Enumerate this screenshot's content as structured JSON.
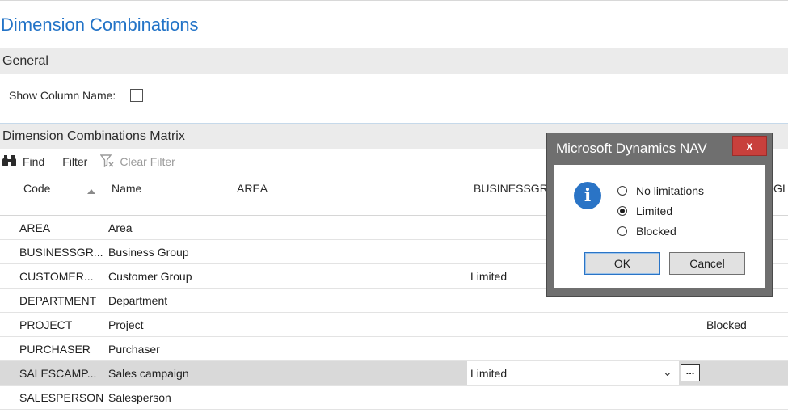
{
  "page": {
    "title": "Dimension Combinations"
  },
  "general": {
    "header": "General",
    "show_column_name_label": "Show Column Name:",
    "show_column_name_checked": false
  },
  "matrix": {
    "header": "Dimension Combinations Matrix",
    "toolbar": {
      "find": "Find",
      "filter": "Filter",
      "clear_filter": "Clear Filter"
    },
    "columns": {
      "code": "Code",
      "name": "Name",
      "area": "AREA",
      "businessgroup": "BUSINESSGR",
      "customergroup_partial": "GI"
    },
    "rows": [
      {
        "code": "AREA",
        "name": "Area",
        "businessgroup": "",
        "customergroup": ""
      },
      {
        "code": "BUSINESSGR...",
        "name": "Business Group",
        "businessgroup": "",
        "customergroup": ""
      },
      {
        "code": "CUSTOMER...",
        "name": "Customer Group",
        "businessgroup": "Limited",
        "customergroup": ""
      },
      {
        "code": "DEPARTMENT",
        "name": "Department",
        "businessgroup": "",
        "customergroup": ""
      },
      {
        "code": "PROJECT",
        "name": "Project",
        "businessgroup": "",
        "customergroup": "Blocked"
      },
      {
        "code": "PURCHASER",
        "name": "Purchaser",
        "businessgroup": "",
        "customergroup": ""
      },
      {
        "code": "SALESCAMP...",
        "name": "Sales campaign",
        "businessgroup": "Limited",
        "customergroup": ""
      },
      {
        "code": "SALESPERSON",
        "name": "Salesperson",
        "businessgroup": "",
        "customergroup": ""
      }
    ],
    "selected_row_index": 6,
    "assist_button_label": "...",
    "dropdown_chevron": "⌄"
  },
  "dialog": {
    "title": "Microsoft Dynamics NAV",
    "close_label": "x",
    "icon": "info-icon",
    "icon_glyph": "i",
    "options": [
      {
        "label": "No limitations",
        "checked": false
      },
      {
        "label": "Limited",
        "checked": true
      },
      {
        "label": "Blocked",
        "checked": false
      }
    ],
    "ok_label": "OK",
    "cancel_label": "Cancel"
  },
  "colors": {
    "title_blue": "#2273c7",
    "dialog_frame": "#6f6f6f",
    "close_red": "#c8403c",
    "info_blue": "#2a74c6",
    "selected_row": "#d9d9d9"
  }
}
